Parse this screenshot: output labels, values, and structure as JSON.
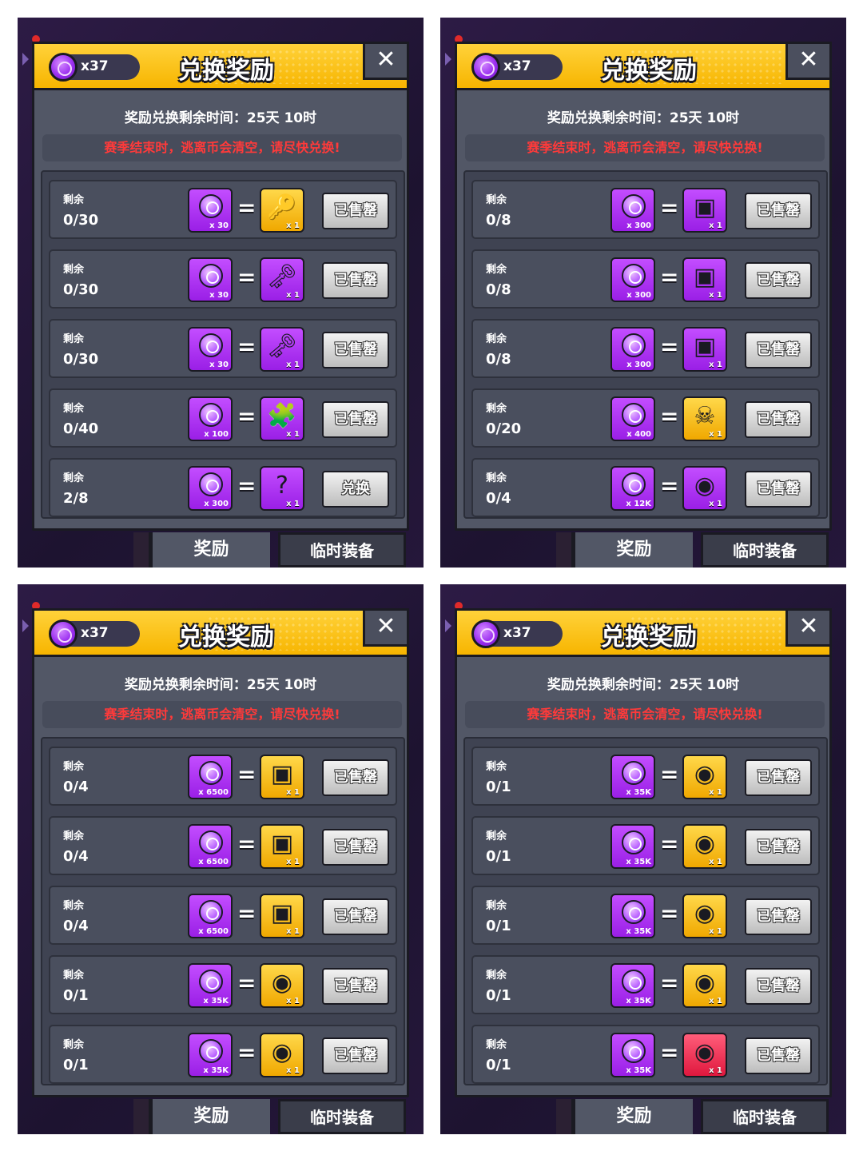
{
  "common": {
    "currency_amount": "x37",
    "title": "兑换奖励",
    "close_symbol": "✕",
    "timer": "奖励兑换剩余时间：25天 10时",
    "warning": "赛季结束时，逃离币会清空，请尽快兑换!",
    "remaining_label": "剩余",
    "tab_rewards": "奖励",
    "tab_temp_gear": "临时装备"
  },
  "colors": {
    "header": "#f7b500",
    "warning": "#ff3a3a",
    "panel": "#525766",
    "gem": "#9a1fe6"
  },
  "screens": [
    {
      "rows": [
        {
          "remaining": "0/30",
          "cost": "x 30",
          "item_icon": "blue-key-icon",
          "item_glyph": "🔑",
          "item_bg": "gold",
          "item_qty": "x 1",
          "action": "已售罄"
        },
        {
          "remaining": "0/30",
          "cost": "x 30",
          "item_icon": "gold-key-icon",
          "item_glyph": "🗝",
          "item_bg": "purple",
          "item_qty": "x 1",
          "action": "已售罄"
        },
        {
          "remaining": "0/30",
          "cost": "x 30",
          "item_icon": "gold-key-icon",
          "item_glyph": "🗝",
          "item_bg": "purple",
          "item_qty": "x 1",
          "action": "已售罄"
        },
        {
          "remaining": "0/40",
          "cost": "x 100",
          "item_icon": "puzzle-piece-icon",
          "item_glyph": "🧩",
          "item_bg": "purple",
          "item_qty": "x 1",
          "action": "已售罄"
        },
        {
          "remaining": "2/8",
          "cost": "x 300",
          "item_icon": "mystery-chest-icon",
          "item_glyph": "?",
          "item_bg": "purple",
          "item_qty": "x 1",
          "action": "兑换"
        }
      ]
    },
    {
      "rows": [
        {
          "remaining": "0/8",
          "cost": "x 300",
          "item_icon": "purple-chest-icon",
          "item_glyph": "▣",
          "item_bg": "purple",
          "item_qty": "x 1",
          "action": "已售罄"
        },
        {
          "remaining": "0/8",
          "cost": "x 300",
          "item_icon": "purple-chest-icon",
          "item_glyph": "▣",
          "item_bg": "purple",
          "item_qty": "x 1",
          "action": "已售罄"
        },
        {
          "remaining": "0/8",
          "cost": "x 300",
          "item_icon": "purple-chest-icon",
          "item_glyph": "▣",
          "item_bg": "purple",
          "item_qty": "x 1",
          "action": "已售罄"
        },
        {
          "remaining": "0/20",
          "cost": "x 400",
          "item_icon": "skull-emblem-icon",
          "item_glyph": "☠",
          "item_bg": "gold",
          "item_qty": "x 1",
          "action": "已售罄"
        },
        {
          "remaining": "0/4",
          "cost": "x 12K",
          "item_icon": "purple-chest-icon",
          "item_glyph": "◉",
          "item_bg": "purple",
          "item_qty": "x 1",
          "action": "已售罄"
        }
      ]
    },
    {
      "rows": [
        {
          "remaining": "0/4",
          "cost": "x 6500",
          "item_icon": "gold-chest-icon",
          "item_glyph": "▣",
          "item_bg": "gold",
          "item_qty": "x 1",
          "action": "已售罄"
        },
        {
          "remaining": "0/4",
          "cost": "x 6500",
          "item_icon": "gold-chest-icon",
          "item_glyph": "▣",
          "item_bg": "gold",
          "item_qty": "x 1",
          "action": "已售罄"
        },
        {
          "remaining": "0/4",
          "cost": "x 6500",
          "item_icon": "gold-chest-icon",
          "item_glyph": "▣",
          "item_bg": "gold",
          "item_qty": "x 1",
          "action": "已售罄"
        },
        {
          "remaining": "0/1",
          "cost": "x 35K",
          "item_icon": "gold-chest-icon",
          "item_glyph": "◉",
          "item_bg": "gold",
          "item_qty": "x 1",
          "action": "已售罄"
        },
        {
          "remaining": "0/1",
          "cost": "x 35K",
          "item_icon": "gold-chest-icon",
          "item_glyph": "◉",
          "item_bg": "gold",
          "item_qty": "x 1",
          "action": "已售罄"
        }
      ]
    },
    {
      "rows": [
        {
          "remaining": "0/1",
          "cost": "x 35K",
          "item_icon": "gold-chest-icon",
          "item_glyph": "◉",
          "item_bg": "gold",
          "item_qty": "x 1",
          "action": "已售罄"
        },
        {
          "remaining": "0/1",
          "cost": "x 35K",
          "item_icon": "gold-chest-icon",
          "item_glyph": "◉",
          "item_bg": "gold",
          "item_qty": "x 1",
          "action": "已售罄"
        },
        {
          "remaining": "0/1",
          "cost": "x 35K",
          "item_icon": "gold-chest-icon",
          "item_glyph": "◉",
          "item_bg": "gold",
          "item_qty": "x 1",
          "action": "已售罄"
        },
        {
          "remaining": "0/1",
          "cost": "x 35K",
          "item_icon": "gold-chest-icon",
          "item_glyph": "◉",
          "item_bg": "gold",
          "item_qty": "x 1",
          "action": "已售罄"
        },
        {
          "remaining": "0/1",
          "cost": "x 35K",
          "item_icon": "red-chest-icon",
          "item_glyph": "◉",
          "item_bg": "red",
          "item_qty": "x 1",
          "action": "已售罄"
        }
      ]
    }
  ]
}
